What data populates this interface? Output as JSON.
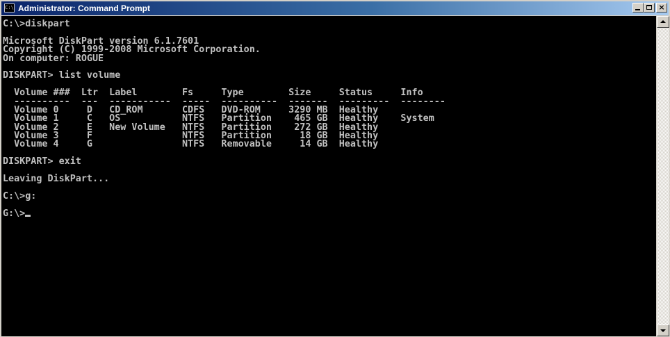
{
  "window": {
    "title": "Administrator: Command Prompt",
    "icon": "cmd-icon",
    "icon_text": "C:\\",
    "controls": {
      "minimize": "minimize-icon",
      "maximize": "maximize-icon",
      "close": "close-icon",
      "close_glyph": "×"
    }
  },
  "colors": {
    "console_bg": "#000000",
    "console_fg": "#c0c0c0",
    "titlebar_start": "#0a246a",
    "titlebar_end": "#a6caf0"
  },
  "console": {
    "lines": [
      "C:\\>diskpart",
      "",
      "Microsoft DiskPart version 6.1.7601",
      "Copyright (C) 1999-2008 Microsoft Corporation.",
      "On computer: ROGUE",
      "",
      "DISKPART> list volume",
      "",
      "  Volume ###  Ltr  Label        Fs     Type        Size     Status     Info",
      "  ----------  ---  -----------  -----  ----------  -------  ---------  --------",
      "  Volume 0     D   CD_ROM       CDFS   DVD-ROM     3290 MB  Healthy",
      "  Volume 1     C   OS           NTFS   Partition    465 GB  Healthy    System",
      "  Volume 2     E   New Volume   NTFS   Partition    272 GB  Healthy",
      "  Volume 3     F                NTFS   Partition     18 GB  Healthy",
      "  Volume 4     G                NTFS   Removable     14 GB  Healthy",
      "",
      "DISKPART> exit",
      "",
      "Leaving DiskPart...",
      "",
      "C:\\>g:",
      "",
      "G:\\>"
    ]
  },
  "scrollbar": {
    "up": "scroll-up-arrow-icon",
    "down": "scroll-down-arrow-icon"
  }
}
